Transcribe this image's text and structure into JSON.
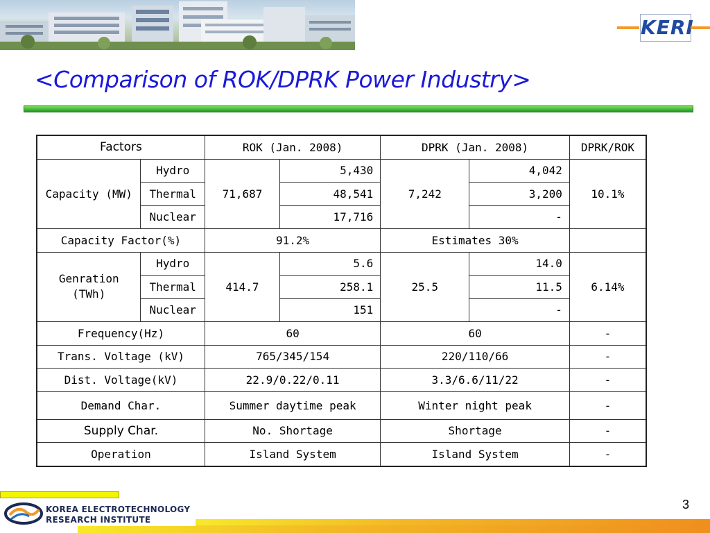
{
  "header": {
    "logo_text": "KERI",
    "title": "<Comparison of ROK/DPRK Power Industry>"
  },
  "table": {
    "headers": [
      "Factors",
      "ROK (Jan. 2008)",
      "DPRK (Jan. 2008)",
      "DPRK/ROK"
    ],
    "capacity": {
      "label": "Capacity (MW)",
      "rows": [
        {
          "type": "Hydro",
          "rok": "5,430",
          "dprk": "4,042"
        },
        {
          "type": "Thermal",
          "rok": "48,541",
          "dprk": "3,200"
        },
        {
          "type": "Nuclear",
          "rok": "17,716",
          "dprk": "-"
        }
      ],
      "rok_total": "71,687",
      "dprk_total": "7,242",
      "ratio": "10.1%"
    },
    "capacity_factor": {
      "label": "Capacity Factor(%)",
      "rok": "91.2%",
      "dprk": "Estimates 30%",
      "ratio": ""
    },
    "generation": {
      "label_line1": "Genration",
      "label_line2": "(TWh)",
      "rows": [
        {
          "type": "Hydro",
          "rok": "5.6",
          "dprk": "14.0"
        },
        {
          "type": "Thermal",
          "rok": "258.1",
          "dprk": "11.5"
        },
        {
          "type": "Nuclear",
          "rok": "151",
          "dprk": "-"
        }
      ],
      "rok_total": "414.7",
      "dprk_total": "25.5",
      "ratio": "6.14%"
    },
    "other_rows": [
      {
        "label": "Frequency(Hz)",
        "rok": "60",
        "dprk": "60",
        "ratio": "-"
      },
      {
        "label": "Trans. Voltage (kV)",
        "rok": "765/345/154",
        "dprk": "220/110/66",
        "ratio": "-"
      },
      {
        "label": "Dist. Voltage(kV)",
        "rok": "22.9/0.22/0.11",
        "dprk": "3.3/6.6/11/22",
        "ratio": "-"
      },
      {
        "label": "Demand Char.",
        "rok": "Summer daytime peak",
        "dprk": "Winter night peak",
        "ratio": "-"
      },
      {
        "label": "Supply Char.",
        "rok": "No. Shortage",
        "dprk": "Shortage",
        "ratio": "-"
      },
      {
        "label": "Operation",
        "rok": "Island System",
        "dprk": "Island System",
        "ratio": "-"
      }
    ]
  },
  "footer": {
    "institute_line1": "KOREA ELECTROTECHNOLOGY",
    "institute_line2": "RESEARCH INSTITUTE",
    "page_number": "3"
  },
  "colors": {
    "title": "#1a1ad9",
    "title_bar": "#3fb83a",
    "accent_orange": "#f39a2a",
    "logo_blue": "#1f4aa0"
  }
}
